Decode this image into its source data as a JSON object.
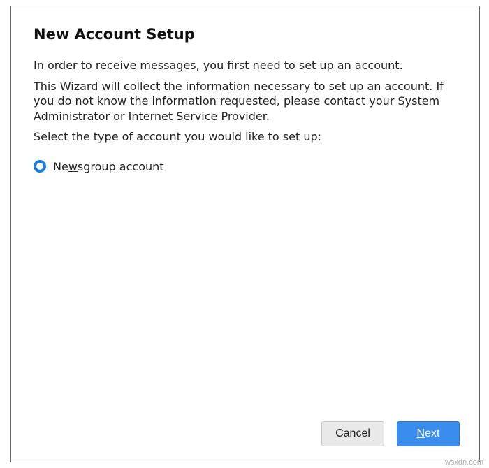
{
  "dialog": {
    "title": "New Account Setup",
    "intro_line1": "In order to receive messages, you first need to set up an account.",
    "intro_line2": "This Wizard will collect the information necessary to set up an account. If you do not know the information requested, please contact your System Administrator or Internet Service Provider.",
    "select_prompt": "Select the type of account you would like to set up:",
    "options": [
      {
        "label_pre": "Ne",
        "label_mnemonic": "w",
        "label_post": "sgroup account",
        "selected": true
      }
    ],
    "buttons": {
      "cancel": "Cancel",
      "next_mnemonic": "N",
      "next_post": "ext"
    }
  },
  "watermark": "wsxdn.com"
}
